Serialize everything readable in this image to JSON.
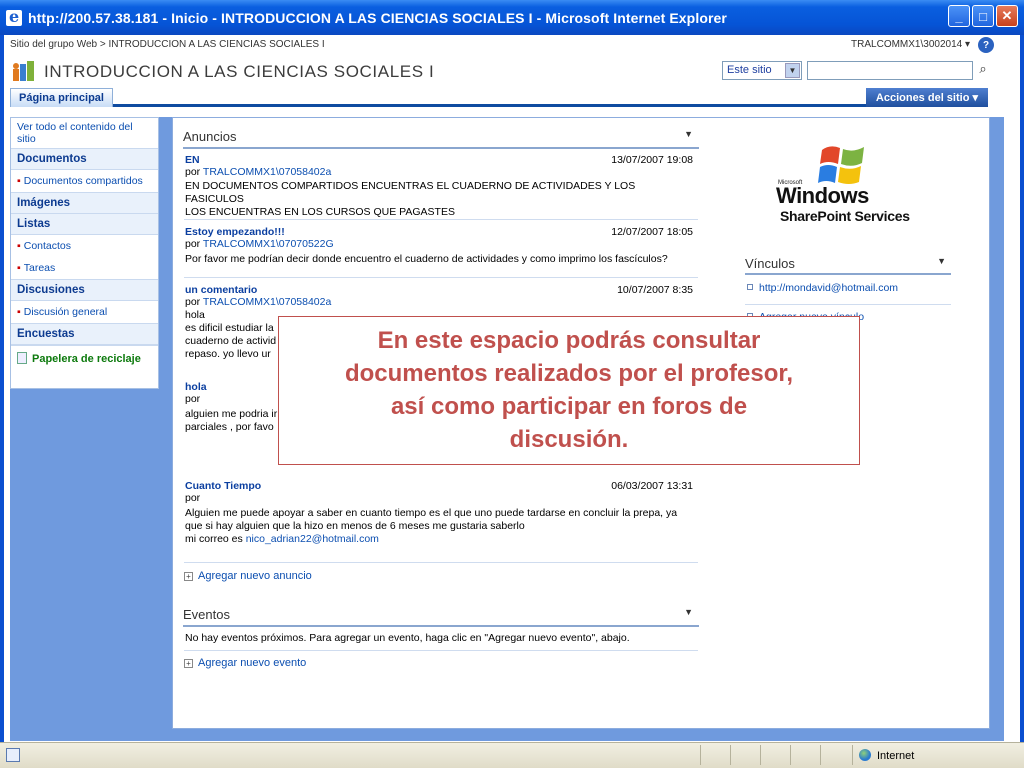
{
  "window": {
    "title": "http://200.57.38.181 - Inicio - INTRODUCCION A LAS CIENCIAS SOCIALES I - Microsoft Internet Explorer",
    "buttons": [
      "_",
      "□",
      "✕"
    ]
  },
  "breadcrumb": "Sitio del grupo Web > INTRODUCCION A LAS CIENCIAS SOCIALES I",
  "user_menu": "TRALCOMMX1\\3002014 ▾",
  "site": {
    "title": "INTRODUCCION A LAS CIENCIAS SOCIALES I",
    "search_scope": "Este sitio",
    "search_value": ""
  },
  "tabs": {
    "home": "Página principal",
    "actions": "Acciones del sitio ▾"
  },
  "leftnav": {
    "view_all": "Ver todo el contenido del sitio",
    "sections": [
      {
        "head": "Documentos",
        "items": [
          "Documentos compartidos"
        ]
      },
      {
        "head": "Imágenes",
        "items": []
      },
      {
        "head": "Listas",
        "items": [
          "Contactos",
          "Tareas"
        ]
      },
      {
        "head": "Discusiones",
        "items": [
          "Discusión general"
        ]
      },
      {
        "head": "Encuestas",
        "items": []
      }
    ],
    "recycle": "Papelera de reciclaje"
  },
  "anuncios": {
    "title": "Anuncios",
    "items": [
      {
        "title": "EN",
        "date": "13/07/2007 19:08",
        "by_prefix": "por",
        "author": "TRALCOMMX1\\07058402a",
        "body": [
          "EN DOCUMENTOS COMPARTIDOS ENCUENTRAS EL CUADERNO DE ACTIVIDADES  Y  LOS FASICULOS",
          "LOS ENCUENTRAS EN LOS CURSOS QUE PAGASTES"
        ]
      },
      {
        "title": "Estoy empezando!!!",
        "date": "12/07/2007 18:05",
        "by_prefix": "por",
        "author": "TRALCOMMX1\\07070522G",
        "body": [
          "Por favor me podrían decir donde encuentro el cuaderno de actividades y como imprimo los fascículos?"
        ]
      },
      {
        "title": "un comentario",
        "date": "10/07/2007 8:35",
        "by_prefix": "por",
        "author": "TRALCOMMX1\\07058402a",
        "body": [
          "hola",
          "es dificil estudiar la",
          "cuaderno de activid",
          "repaso.  yo llevo ur"
        ]
      },
      {
        "title": "hola",
        "date": "",
        "by_prefix": "por",
        "author": "",
        "body": [
          "alguien me podria ir",
          "parciales , por favo"
        ]
      },
      {
        "title": "Cuanto Tiempo",
        "date": "06/03/2007 13:31",
        "by_prefix": "por",
        "author": "",
        "body": [
          "Alguien me puede apoyar a saber en cuanto tiempo es el que uno puede tardarse en concluir la prepa, ya",
          "que si hay alguien que la hizo en menos de 6 meses me gustaria saberlo"
        ],
        "mail_prefix": "mi correo es ",
        "mail": "nico_adrian22@hotmail.com"
      }
    ],
    "add_link": "Agregar nuevo anuncio"
  },
  "eventos": {
    "title": "Eventos",
    "empty_text": "No hay eventos próximos. Para agregar un evento, haga clic en \"Agregar nuevo evento\", abajo.",
    "add_link": "Agregar nuevo evento"
  },
  "logo": {
    "microsoft": "Microsoft",
    "windows": "Windows",
    "sharepoint": "SharePoint Services"
  },
  "vinculos": {
    "title": "Vínculos",
    "items": [
      "http://mondavid@hotmail.com"
    ],
    "add_link": "Agregar nuevo vínculo"
  },
  "callout": {
    "lines": [
      "En este espacio podrás consultar",
      "documentos realizados por el profesor,",
      "así como participar en foros de",
      "discusión."
    ]
  },
  "status": {
    "zone": "Internet"
  },
  "colors": {
    "titlebar": "#0654d6",
    "link": "#0b4eb0",
    "callout": "#c0504d",
    "frame": "#6f9ade"
  }
}
